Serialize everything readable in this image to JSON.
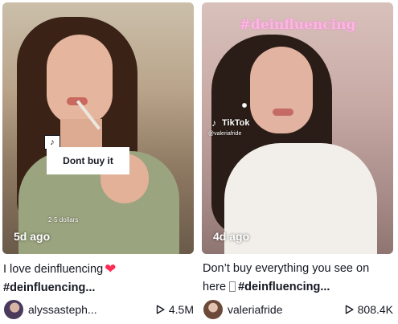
{
  "videos": [
    {
      "sticker_text": "Dont buy it",
      "overlay_small_text": "2-5 dollars",
      "age": "5d ago",
      "caption": "I love deinfluencing",
      "hashtags": "#deinfluencing...",
      "username": "alyssasteph...",
      "views": "4.5M",
      "icons": [
        "tiktok-note-icon",
        "red-heart-emoji",
        "play-icon"
      ]
    },
    {
      "overlay_hashtag": "#deinfluencing",
      "watermark_brand": "TikTok",
      "watermark_user": "@valeriafride",
      "age": "4d ago",
      "caption_line1": "Don’t buy everything you see on",
      "caption_line2_prefix": "here",
      "hashtags": "#deinfluencing...",
      "username": "valeriafride",
      "views": "808.4K",
      "icons": [
        "tiktok-note-icon",
        "play-icon"
      ]
    }
  ],
  "colors": {
    "text": "#161823",
    "heart": "#fe2c55",
    "hashtag_overlay": "#ffb3e6"
  }
}
